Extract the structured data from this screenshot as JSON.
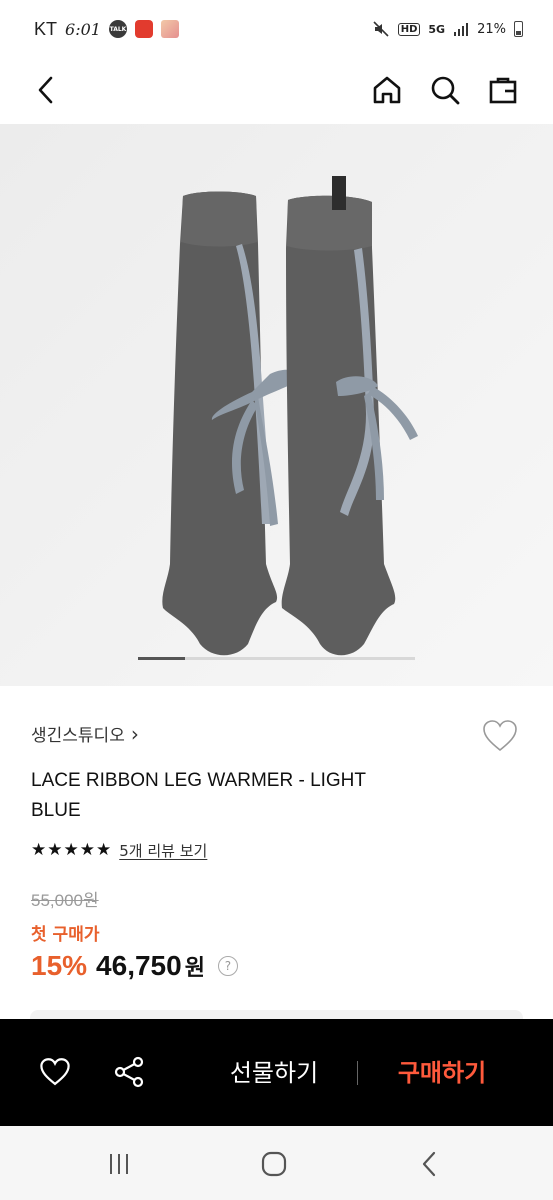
{
  "status_bar": {
    "carrier": "KT",
    "time": "6:01",
    "talk_label": "TALK",
    "hd_label": "HD",
    "network_label": "5G",
    "battery": "21%"
  },
  "header": {
    "icons": [
      "back-icon",
      "home-icon",
      "search-icon",
      "shopping-bag-icon"
    ]
  },
  "gallery": {
    "progress": 0.17
  },
  "product": {
    "brand": "생긴스튜디오",
    "brand_chevron": "›",
    "name": "LACE RIBBON LEG WARMER - LIGHT BLUE",
    "stars": 5,
    "review_link": "5개 리뷰 보기",
    "original_price": "55,000원",
    "first_purchase_label": "첫 구매가",
    "discount": "15%",
    "final_price": "46,750",
    "currency": "원",
    "help": "?"
  },
  "action_bar": {
    "gift_label": "선물하기",
    "buy_label": "구매하기"
  },
  "colors": {
    "accent": "#e8602c",
    "buy_text": "#ff5a3c",
    "action_bar_bg": "#000000"
  }
}
